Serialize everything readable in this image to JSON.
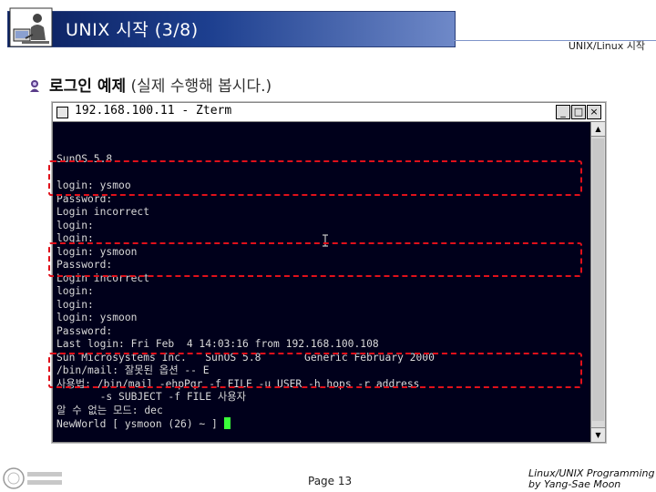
{
  "header": {
    "title": "UNIX 시작 (3/8)",
    "corner_label": "UNIX/Linux 시작"
  },
  "subtitle": {
    "bold": "로그인 예제",
    "light": "(실제 수행해 봅시다.)"
  },
  "terminal": {
    "window_title": "192.168.100.11 - Zterm",
    "buttons": {
      "minimize": "_",
      "maximize": "□",
      "close": "×"
    },
    "lines": [
      "SunOS 5.8",
      "",
      "login: ysmoo",
      "Password:",
      "Login incorrect",
      "login:",
      "login:",
      "login: ysmoon",
      "Password:",
      "Login incorrect",
      "login:",
      "login:",
      "login: ysmoon",
      "Password:",
      "Last login: Fri Feb  4 14:03:16 from 192.168.100.108",
      "Sun Microsystems Inc.   SunOS 5.8       Generic February 2000",
      "/bin/mail: 잘못된 옵션 -- E",
      "사용법: /bin/mail -ehpPqr -f FILE -u USER -h hops -r address",
      "       -s SUBJECT -f FILE 사용자",
      "알 수 없는 모드: dec",
      "NewWorld [ ysmoon (26) ~ ] "
    ],
    "cursor_color": "#39ff39",
    "background": "#00001b"
  },
  "footer": {
    "page": "Page 13",
    "course_line1": "Linux/UNIX Programming",
    "course_line2": "by Yang-Sae Moon"
  },
  "colors": {
    "title_bar": "#1d3f8f",
    "highlight": "#e0101a"
  }
}
